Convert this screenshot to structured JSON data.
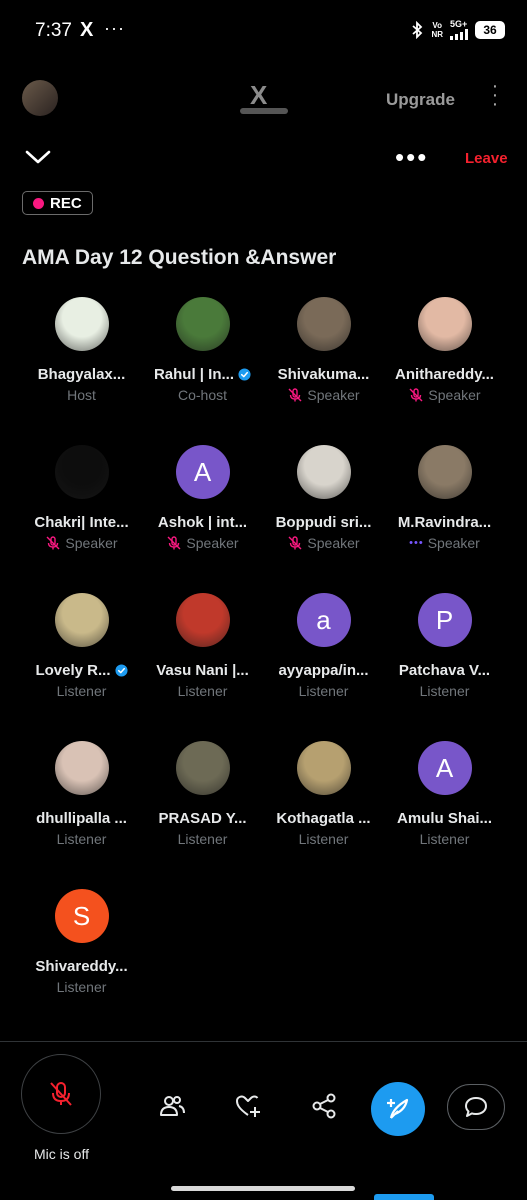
{
  "status_bar": {
    "time": "7:37",
    "x_icon": "X",
    "dots": "···",
    "network_top": "Vo",
    "network_bottom": "NR",
    "network_type": "5G+",
    "battery": "36"
  },
  "top_nav": {
    "logo": "X",
    "upgrade_label": "Upgrade"
  },
  "space": {
    "leave_label": "Leave",
    "rec_label": "REC",
    "title": "AMA Day 12 Question &Answer"
  },
  "participants": [
    {
      "name": "Bhagyalax...",
      "role": "Host",
      "muted": false,
      "verified": false,
      "speaking": false,
      "avatar_type": "photo",
      "avatar_color": "#e8efe3",
      "avatar_letter": ""
    },
    {
      "name": "Rahul | In...",
      "role": "Co-host",
      "muted": false,
      "verified": true,
      "speaking": false,
      "avatar_type": "photo",
      "avatar_color": "#4a7a3a",
      "avatar_letter": ""
    },
    {
      "name": "Shivakuma...",
      "role": "Speaker",
      "muted": true,
      "verified": false,
      "speaking": false,
      "avatar_type": "photo",
      "avatar_color": "#7a6a58",
      "avatar_letter": ""
    },
    {
      "name": "Anithareddy...",
      "role": "Speaker",
      "muted": true,
      "verified": false,
      "speaking": false,
      "avatar_type": "photo",
      "avatar_color": "#e2b9a4",
      "avatar_letter": ""
    },
    {
      "name": "Chakri| Inte...",
      "role": "Speaker",
      "muted": true,
      "verified": false,
      "speaking": false,
      "avatar_type": "photo",
      "avatar_color": "#0d0d0d",
      "avatar_letter": ""
    },
    {
      "name": "Ashok | int...",
      "role": "Speaker",
      "muted": true,
      "verified": false,
      "speaking": false,
      "avatar_type": "letter",
      "avatar_color": "#7856c9",
      "avatar_letter": "A"
    },
    {
      "name": "Boppudi sri...",
      "role": "Speaker",
      "muted": true,
      "verified": false,
      "speaking": false,
      "avatar_type": "photo",
      "avatar_color": "#d8d4cc",
      "avatar_letter": ""
    },
    {
      "name": "M.Ravindra...",
      "role": "Speaker",
      "muted": false,
      "verified": false,
      "speaking": true,
      "avatar_type": "photo",
      "avatar_color": "#8a7a66",
      "avatar_letter": ""
    },
    {
      "name": "Lovely R...",
      "role": "Listener",
      "muted": false,
      "verified": true,
      "speaking": false,
      "avatar_type": "photo",
      "avatar_color": "#c9b98a",
      "avatar_letter": ""
    },
    {
      "name": "Vasu Nani |...",
      "role": "Listener",
      "muted": false,
      "verified": false,
      "speaking": false,
      "avatar_type": "photo",
      "avatar_color": "#c0392b",
      "avatar_letter": ""
    },
    {
      "name": "ayyappa/in...",
      "role": "Listener",
      "muted": false,
      "verified": false,
      "speaking": false,
      "avatar_type": "letter",
      "avatar_color": "#7856c9",
      "avatar_letter": "a"
    },
    {
      "name": "Patchava V...",
      "role": "Listener",
      "muted": false,
      "verified": false,
      "speaking": false,
      "avatar_type": "letter",
      "avatar_color": "#7856c9",
      "avatar_letter": "P"
    },
    {
      "name": "dhullipalla ...",
      "role": "Listener",
      "muted": false,
      "verified": false,
      "speaking": false,
      "avatar_type": "photo",
      "avatar_color": "#d9c2b5",
      "avatar_letter": ""
    },
    {
      "name": "PRASAD Y...",
      "role": "Listener",
      "muted": false,
      "verified": false,
      "speaking": false,
      "avatar_type": "photo",
      "avatar_color": "#6d6a55",
      "avatar_letter": ""
    },
    {
      "name": "Kothagatla ...",
      "role": "Listener",
      "muted": false,
      "verified": false,
      "speaking": false,
      "avatar_type": "photo",
      "avatar_color": "#b6a070",
      "avatar_letter": ""
    },
    {
      "name": "Amulu Shai...",
      "role": "Listener",
      "muted": false,
      "verified": false,
      "speaking": false,
      "avatar_type": "letter",
      "avatar_color": "#7856c9",
      "avatar_letter": "A"
    },
    {
      "name": "Shivareddy...",
      "role": "Listener",
      "muted": false,
      "verified": false,
      "speaking": false,
      "avatar_type": "letter",
      "avatar_color": "#f4511e",
      "avatar_letter": "S"
    }
  ],
  "bottom_bar": {
    "mic_label": "Mic is off",
    "icons": [
      "mic-off-icon",
      "people-icon",
      "heart-add-icon",
      "share-icon",
      "compose-icon",
      "comment-icon"
    ]
  },
  "colors": {
    "background": "#000000",
    "accent": "#1d9bf0",
    "leave": "#f4212e",
    "rec": "#f91880",
    "muted_text": "#71767b",
    "letter_avatar_purple": "#7856c9",
    "letter_avatar_orange": "#f4511e"
  }
}
